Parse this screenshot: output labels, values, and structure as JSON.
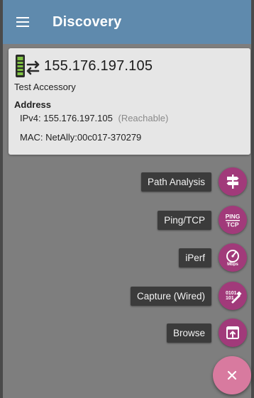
{
  "app_bar": {
    "title": "Discovery",
    "menu_icon": "hamburger-menu-icon"
  },
  "device": {
    "icon": "tester-device-icon",
    "ip": "155.176.197.105",
    "name": "Test Accessory",
    "address_heading": "Address",
    "ipv4_label": "IPv4:",
    "ipv4_value": "155.176.197.105",
    "ipv4_status": "(Reachable)",
    "mac_label": "MAC:",
    "mac_value": "NetAlly:00c017-370279"
  },
  "actions": [
    {
      "label": "Path Analysis",
      "icon": "signpost-icon"
    },
    {
      "label": "Ping/TCP",
      "icon": "ping-tcp-icon"
    },
    {
      "label": "iPerf",
      "icon": "speedometer-icon"
    },
    {
      "label": "Capture (Wired)",
      "icon": "capture-icon"
    },
    {
      "label": "Browse",
      "icon": "browse-icon"
    }
  ],
  "main_fab": {
    "icon": "close-icon",
    "glyph": "×"
  },
  "colors": {
    "app_bar": "#5f8aad",
    "overlay": "#7e7e7e",
    "card": "#e6e6e6",
    "mini_fab": "#a13a7a",
    "main_fab": "#d87a9f",
    "label_bg": "#3b3b3b"
  }
}
